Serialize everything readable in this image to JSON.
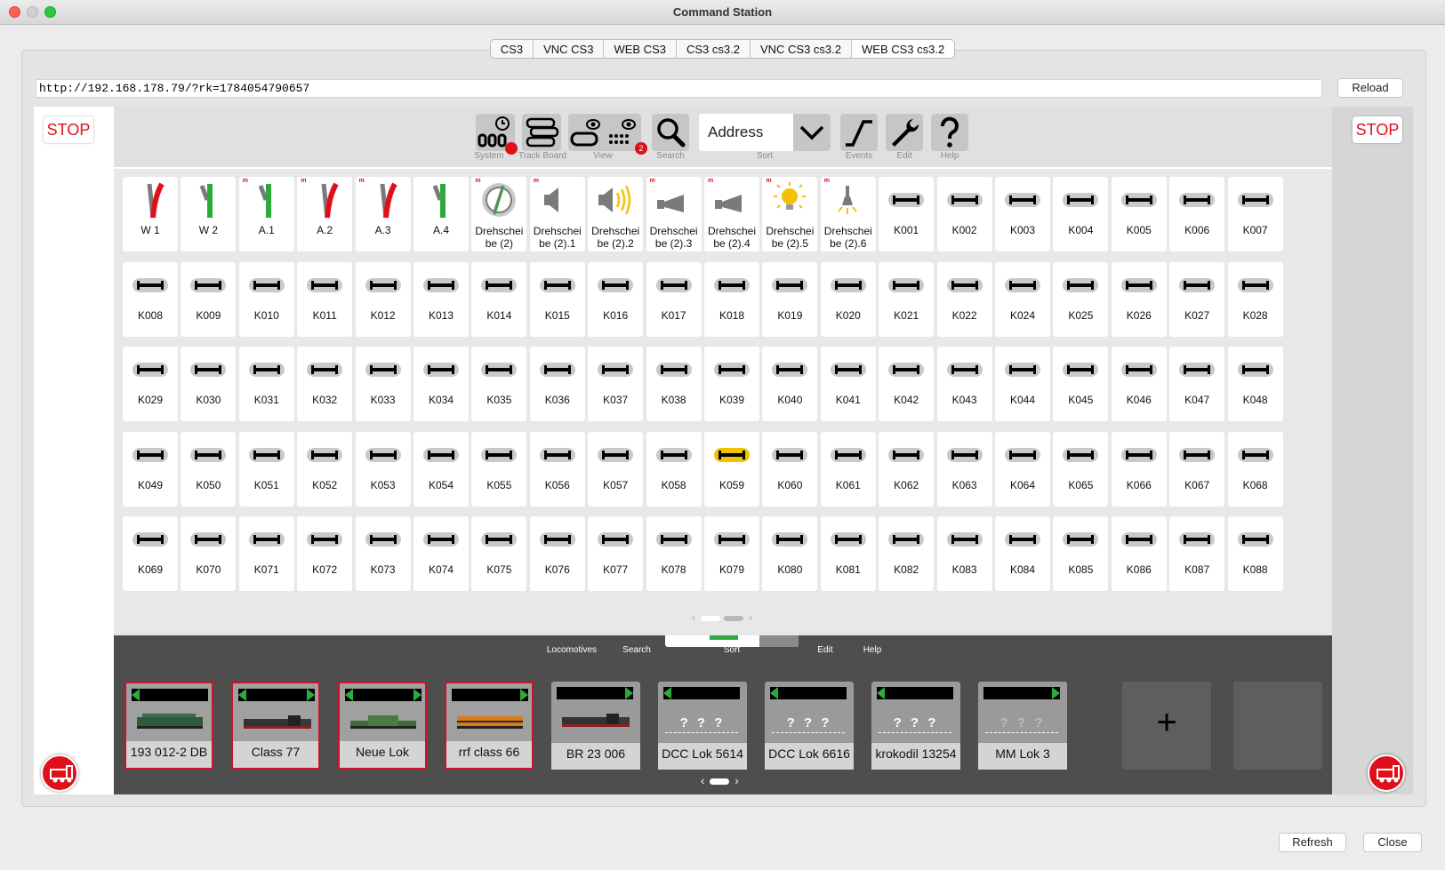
{
  "window": {
    "title": "Command Station"
  },
  "tabs": [
    "CS3",
    "VNC CS3",
    "WEB CS3",
    "CS3 cs3.2",
    "VNC CS3 cs3.2",
    "WEB CS3 cs3.2"
  ],
  "active_tab": 5,
  "url": {
    "value": "http://192.168.178.79/?rk=1784054790657"
  },
  "buttons": {
    "reload": "Reload",
    "refresh": "Refresh",
    "close": "Close"
  },
  "stop_label": "STOP",
  "toolbar": {
    "system": "System",
    "track_board": "Track Board",
    "view": "View",
    "view_badge": "2",
    "search": "Search",
    "sort_value": "Address",
    "sort": "Sort",
    "events": "Events",
    "edit": "Edit",
    "help": "Help"
  },
  "articles_row1": [
    {
      "label": "W 1",
      "icon": "turnout-red-icon",
      "m": false
    },
    {
      "label": "W 2",
      "icon": "turnout-green-icon",
      "m": false
    },
    {
      "label": "A.1",
      "icon": "turnout-green-icon",
      "m": true
    },
    {
      "label": "A.2",
      "icon": "turnout-red-icon",
      "m": true
    },
    {
      "label": "A.3",
      "icon": "turnout-red-icon",
      "m": true
    },
    {
      "label": "A.4",
      "icon": "turnout-green-icon",
      "m": false
    },
    {
      "label": "Drehscheibe (2)",
      "l1": "Drehschei",
      "l2": "be (2)",
      "icon": "turntable-icon",
      "m": true
    },
    {
      "label": "Drehscheibe (2).1",
      "l1": "Drehschei",
      "l2": "be (2).1",
      "icon": "speaker-off-icon",
      "m": true
    },
    {
      "label": "Drehscheibe (2).2",
      "l1": "Drehschei",
      "l2": "be (2).2",
      "icon": "speaker-on-icon",
      "m": false
    },
    {
      "label": "Drehscheibe (2).3",
      "l1": "Drehschei",
      "l2": "be (2).3",
      "icon": "horn-icon",
      "m": true
    },
    {
      "label": "Drehscheibe (2).4",
      "l1": "Drehschei",
      "l2": "be (2).4",
      "icon": "horn-icon",
      "m": true
    },
    {
      "label": "Drehscheibe (2).5",
      "l1": "Drehschei",
      "l2": "be (2).5",
      "icon": "lightbulb-icon",
      "m": true
    },
    {
      "label": "Drehscheibe (2).6",
      "l1": "Drehschei",
      "l2": "be (2).6",
      "icon": "lamp-icon",
      "m": true
    },
    {
      "label": "K001",
      "icon": "uncoupler-icon"
    },
    {
      "label": "K002",
      "icon": "uncoupler-icon"
    },
    {
      "label": "K003",
      "icon": "uncoupler-icon"
    },
    {
      "label": "K004",
      "icon": "uncoupler-icon"
    },
    {
      "label": "K005",
      "icon": "uncoupler-icon"
    },
    {
      "label": "K006",
      "icon": "uncoupler-icon"
    },
    {
      "label": "K007",
      "icon": "uncoupler-icon"
    }
  ],
  "article_rows": [
    [
      "K008",
      "K009",
      "K010",
      "K011",
      "K012",
      "K013",
      "K014",
      "K015",
      "K016",
      "K017",
      "K018",
      "K019",
      "K020",
      "K021",
      "K022",
      "K024",
      "K025",
      "K026",
      "K027",
      "K028"
    ],
    [
      "K029",
      "K030",
      "K031",
      "K032",
      "K033",
      "K034",
      "K035",
      "K036",
      "K037",
      "K038",
      "K039",
      "K040",
      "K041",
      "K042",
      "K043",
      "K044",
      "K045",
      "K046",
      "K047",
      "K048"
    ],
    [
      "K049",
      "K050",
      "K051",
      "K052",
      "K053",
      "K054",
      "K055",
      "K056",
      "K057",
      "K058",
      "K059",
      "K060",
      "K061",
      "K062",
      "K063",
      "K064",
      "K065",
      "K066",
      "K067",
      "K068"
    ],
    [
      "K069",
      "K070",
      "K071",
      "K072",
      "K073",
      "K074",
      "K075",
      "K076",
      "K077",
      "K078",
      "K079",
      "K080",
      "K081",
      "K082",
      "K083",
      "K084",
      "K085",
      "K086",
      "K087",
      "K088"
    ]
  ],
  "active_article": "K059",
  "pager_arrows": {
    "prev": "‹",
    "next": "›"
  },
  "lok_toolbar": {
    "locomotives": "Locomotives",
    "search": "Search",
    "sort": "Sort",
    "edit": "Edit",
    "help": "Help"
  },
  "locomotives": [
    {
      "name": "193 012-2 DB",
      "selected": true,
      "has_image": true,
      "image": "green-electric-loco"
    },
    {
      "name": "Class 77",
      "selected": true,
      "has_image": true,
      "image": "steam-loco"
    },
    {
      "name": "Neue Lok",
      "selected": true,
      "has_image": true,
      "image": "green-crocodile-loco"
    },
    {
      "name": "rrf class 66",
      "selected": true,
      "has_image": true,
      "image": "orange-diesel-loco"
    },
    {
      "name": "BR 23 006",
      "selected": false,
      "has_image": true,
      "image": "steam-loco"
    },
    {
      "name": "DCC Lok 5614",
      "selected": false,
      "has_image": false,
      "placeholder": "? ? ?"
    },
    {
      "name": "DCC Lok 6616",
      "selected": false,
      "has_image": false,
      "placeholder": "? ? ?"
    },
    {
      "name": "krokodil 13254",
      "selected": false,
      "has_image": false,
      "placeholder": "? ? ?"
    },
    {
      "name": "MM Lok 3",
      "selected": false,
      "has_image": false,
      "placeholder": "? ? ?",
      "dim": true
    }
  ],
  "add_loco_label": "+"
}
